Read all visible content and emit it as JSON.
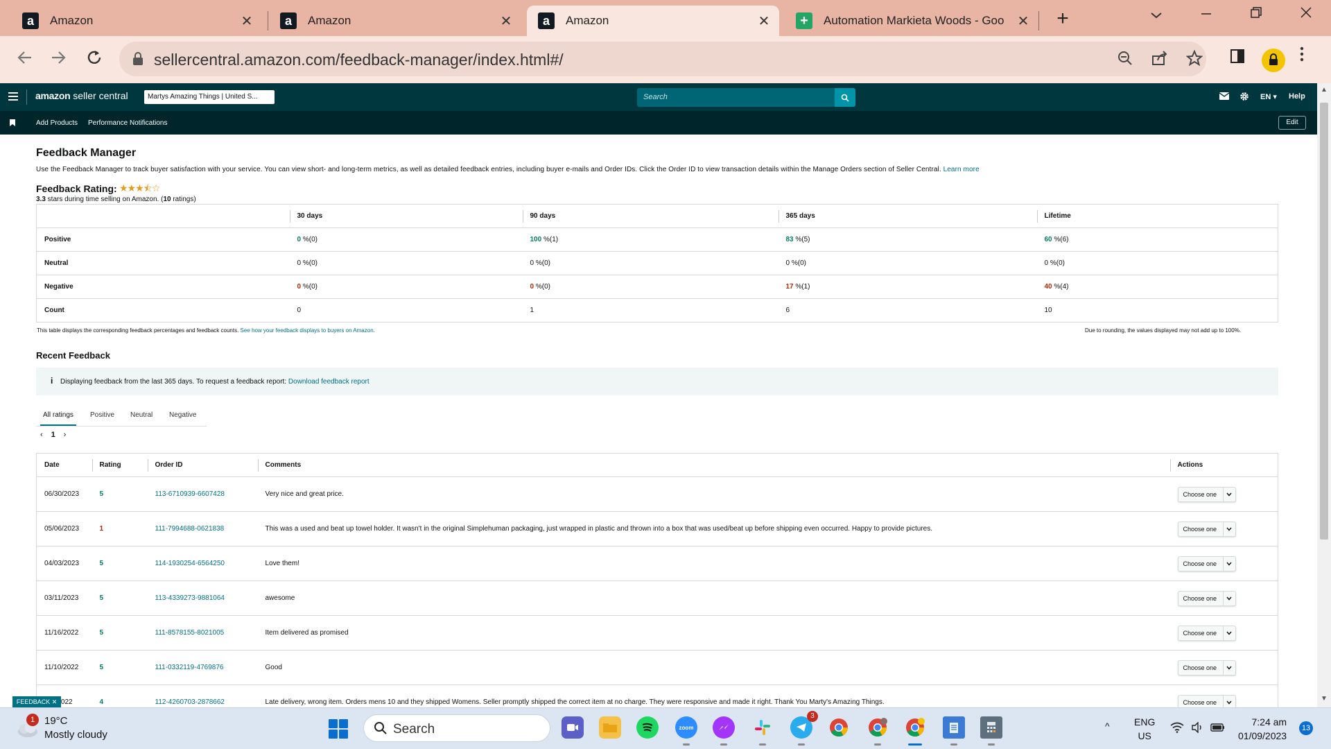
{
  "browser": {
    "tabs": [
      {
        "title": "Amazon",
        "favicon": "amazon-icon"
      },
      {
        "title": "Amazon",
        "favicon": "amazon-icon"
      },
      {
        "title": "Amazon",
        "favicon": "amazon-icon",
        "active": true
      },
      {
        "title": "Automation Markieta Woods - Goo",
        "favicon": "sheets-icon"
      }
    ],
    "favicon_letters": {
      "amazon": "a",
      "sheets": "+"
    },
    "close_glyph": "✕",
    "new_tab": "+",
    "url": "sellercentral.amazon.com/feedback-manager/index.html#/"
  },
  "seller_central": {
    "logo_brand": "amazon",
    "logo_suffix": "seller central",
    "store": "Martys Amazing Things | United S...",
    "search_placeholder": "Search",
    "language": "EN ▾",
    "help": "Help",
    "nav": {
      "add_products": "Add Products",
      "performance": "Performance Notifications",
      "edit": "Edit"
    }
  },
  "page": {
    "title": "Feedback Manager",
    "intro": "Use the Feedback Manager to track buyer satisfaction with your service. You can view short- and long-term metrics, as well as detailed feedback entries, including buyer e-mails and Order IDs. Click the Order ID to view transaction details within the Manage Orders section of Seller Central.",
    "learn_more": "Learn more",
    "rating_label": "Feedback Rating:",
    "rating_value": 3.3,
    "stars": "★★★⯪☆",
    "rating_stars_text": "3.3",
    "rating_sub_mid": " stars during time selling on Amazon. (",
    "rating_count": "10",
    "rating_sub_end": " ratings)",
    "summary": {
      "columns": [
        "30 days",
        "90 days",
        "365 days",
        "Lifetime"
      ],
      "rows": [
        {
          "label": "Positive",
          "cells": [
            {
              "pct": "0",
              "rest": " %(0)",
              "tone": "g"
            },
            {
              "pct": "100",
              "rest": " %(1)",
              "tone": "g"
            },
            {
              "pct": "83",
              "rest": " %(5)",
              "tone": "g"
            },
            {
              "pct": "60",
              "rest": " %(6)",
              "tone": "g"
            }
          ]
        },
        {
          "label": "Neutral",
          "cells": [
            {
              "pct": "0",
              "rest": " %(0)",
              "tone": ""
            },
            {
              "pct": "0",
              "rest": " %(0)",
              "tone": ""
            },
            {
              "pct": "0",
              "rest": " %(0)",
              "tone": ""
            },
            {
              "pct": "0",
              "rest": " %(0)",
              "tone": ""
            }
          ]
        },
        {
          "label": "Negative",
          "cells": [
            {
              "pct": "0",
              "rest": " %(0)",
              "tone": "r"
            },
            {
              "pct": "0",
              "rest": " %(0)",
              "tone": "r"
            },
            {
              "pct": "17",
              "rest": " %(1)",
              "tone": "r"
            },
            {
              "pct": "40",
              "rest": " %(4)",
              "tone": "r"
            }
          ]
        },
        {
          "label": "Count",
          "cells": [
            {
              "pct": "",
              "rest": "0",
              "tone": ""
            },
            {
              "pct": "",
              "rest": "1",
              "tone": ""
            },
            {
              "pct": "",
              "rest": "6",
              "tone": ""
            },
            {
              "pct": "",
              "rest": "10",
              "tone": ""
            }
          ]
        }
      ],
      "note": "This table displays the corresponding feedback percentages and feedback counts.",
      "note_link": "See how your feedback displays to buyers on Amazon.",
      "rounding_note": "Due to rounding, the values displayed may not add up to 100%."
    },
    "recent": {
      "title": "Recent Feedback",
      "info_icon": "i",
      "info": "Displaying feedback from the last 365 days. To request a feedback report:",
      "info_link": "Download feedback report",
      "tabs": [
        "All ratings",
        "Positive",
        "Neutral",
        "Negative"
      ],
      "page": "1",
      "prev": "‹",
      "next": "›",
      "columns": [
        "Date",
        "Rating",
        "Order ID",
        "Comments",
        "Actions"
      ],
      "action_label": "Choose one",
      "rows": [
        {
          "date": "06/30/2023",
          "rating": "5",
          "order": "113-6710939-6607428",
          "comment": "Very nice and great price."
        },
        {
          "date": "05/06/2023",
          "rating": "1",
          "order": "111-7994688-0621838",
          "comment": "This was a used and beat up towel holder. It wasn't in the original Simplehuman packaging, just wrapped in plastic and thrown into a box that was used/beat up before shipping even occurred. Happy to provide pictures."
        },
        {
          "date": "04/03/2023",
          "rating": "5",
          "order": "114-1930254-6564250",
          "comment": "Love them!"
        },
        {
          "date": "03/11/2023",
          "rating": "5",
          "order": "113-4339273-9881064",
          "comment": "awesome"
        },
        {
          "date": "11/16/2022",
          "rating": "5",
          "order": "111-8578155-8021005",
          "comment": "Item delivered as promised"
        },
        {
          "date": "11/10/2022",
          "rating": "5",
          "order": "111-0332119-4769876",
          "comment": "Good"
        },
        {
          "date": "…8/2022",
          "rating": "4",
          "order": "112-4260703-2878662",
          "comment": "Late delivery, wrong item. Orders mens 10 and they shipped Womens. Seller promptly shipped the correct item at no charge. They were responsive and made it right. Thank You Marty's Amazing Things."
        }
      ]
    },
    "feedback_tag": "FEEDBACK ✕"
  },
  "taskbar": {
    "weather_temp": "19°C",
    "weather_desc": "Mostly cloudy",
    "weather_badge": "1",
    "search": "Search",
    "telegram_badge": "3",
    "lang_top": "ENG",
    "lang_bottom": "US",
    "time": "7:24 am",
    "date": "01/09/2023",
    "notifications": "13",
    "chevron": "^"
  },
  "colors": {
    "positive": "#067d62",
    "negative": "#b12704",
    "link": "#007185",
    "header": "#00363e",
    "tab_strip": "#e8b4a3"
  }
}
